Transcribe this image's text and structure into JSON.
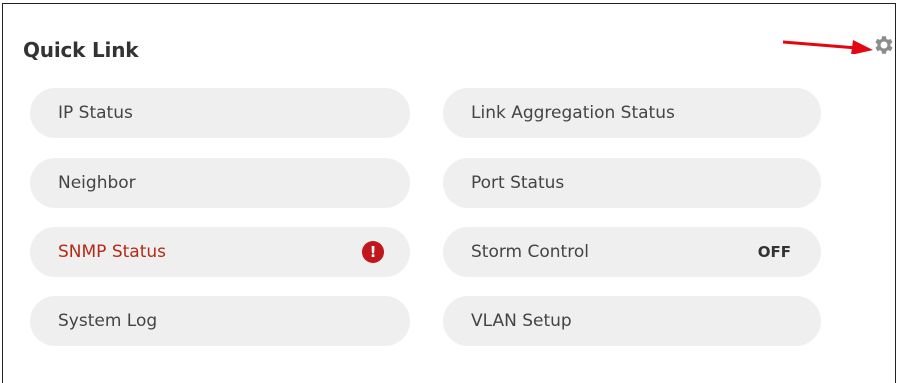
{
  "panel": {
    "title": "Quick Link",
    "settings_icon": "gear-icon"
  },
  "links": {
    "ip_status": {
      "label": "IP Status"
    },
    "link_aggregation_status": {
      "label": "Link Aggregation Status"
    },
    "neighbor": {
      "label": "Neighbor"
    },
    "port_status": {
      "label": "Port Status"
    },
    "snmp_status": {
      "label": "SNMP Status",
      "alert_symbol": "!",
      "alert_icon": "exclamation-icon"
    },
    "storm_control": {
      "label": "Storm Control",
      "state": "OFF"
    },
    "system_log": {
      "label": "System Log"
    },
    "vlan_setup": {
      "label": "VLAN Setup"
    }
  },
  "colors": {
    "alert_text": "#b22b16",
    "alert_badge": "#c0161c",
    "annotation_arrow": "#e30613",
    "pill_background": "#efefef"
  }
}
